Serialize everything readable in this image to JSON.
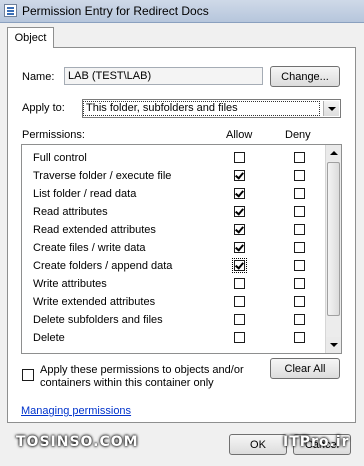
{
  "window": {
    "title": "Permission Entry for Redirect Docs"
  },
  "tabs": [
    {
      "label": "Object"
    }
  ],
  "name_label": "Name:",
  "name_value": "LAB (TEST\\LAB)",
  "change_button": "Change...",
  "apply_to_label": "Apply to:",
  "apply_to_value": "This folder, subfolders and files",
  "permissions_label": "Permissions:",
  "allow_header": "Allow",
  "deny_header": "Deny",
  "permissions": [
    {
      "label": "Full control",
      "allow": false,
      "deny": false
    },
    {
      "label": "Traverse folder / execute file",
      "allow": true,
      "deny": false
    },
    {
      "label": "List folder / read data",
      "allow": true,
      "deny": false
    },
    {
      "label": "Read attributes",
      "allow": true,
      "deny": false
    },
    {
      "label": "Read extended attributes",
      "allow": true,
      "deny": false
    },
    {
      "label": "Create files / write data",
      "allow": true,
      "deny": false
    },
    {
      "label": "Create folders / append data",
      "allow": true,
      "deny": false
    },
    {
      "label": "Write attributes",
      "allow": false,
      "deny": false
    },
    {
      "label": "Write extended attributes",
      "allow": false,
      "deny": false
    },
    {
      "label": "Delete subfolders and files",
      "allow": false,
      "deny": false
    },
    {
      "label": "Delete",
      "allow": false,
      "deny": false
    }
  ],
  "apply_checkbox_label_1": "Apply these permissions to objects and/or",
  "apply_checkbox_label_2": "containers within this container only",
  "clear_all_button": "Clear All",
  "managing_link": "Managing permissions",
  "ok_button": "OK",
  "cancel_button": "Cancel",
  "watermark_left": "TOSINSO.COM",
  "watermark_right": "ITPro.ir"
}
